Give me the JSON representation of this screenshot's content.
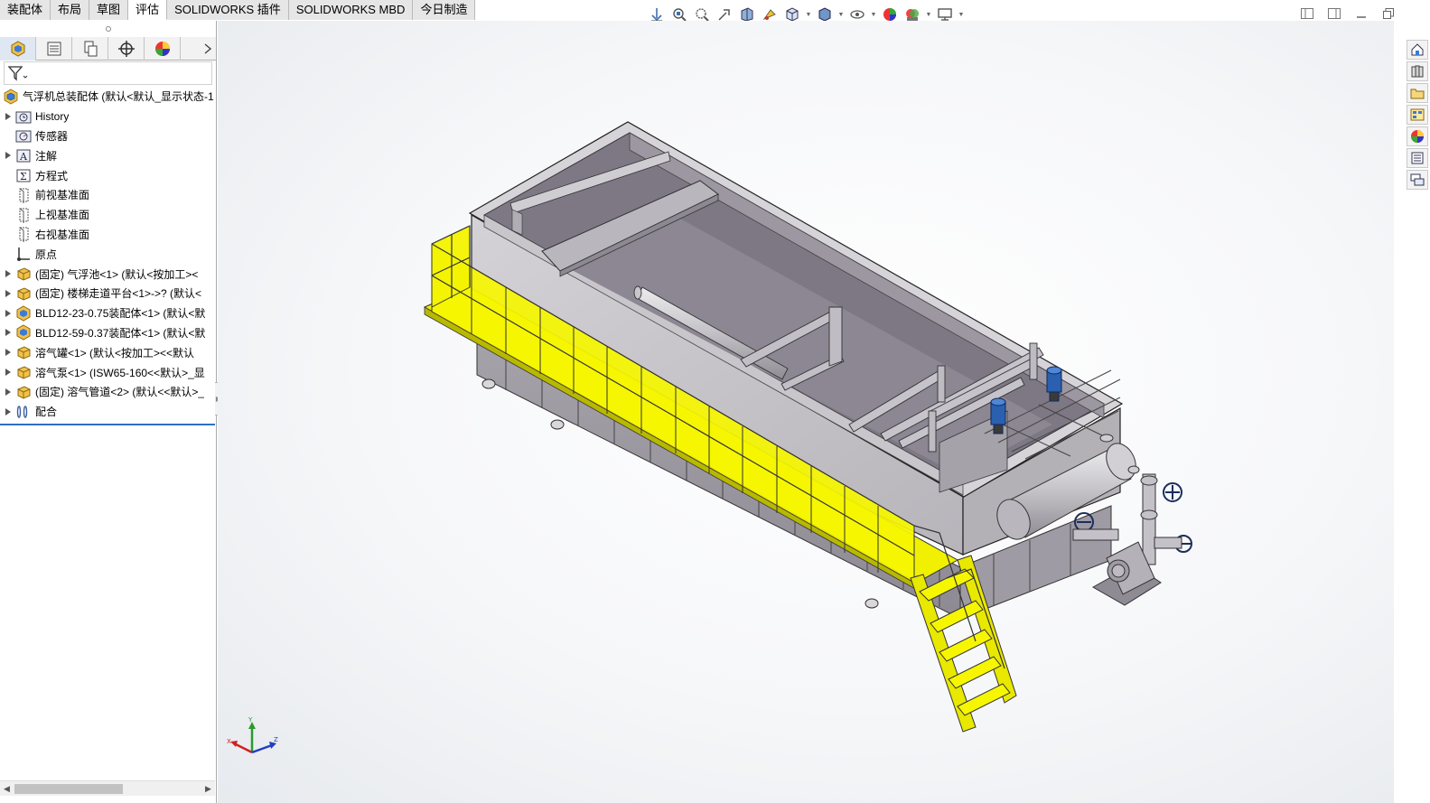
{
  "tabs": [
    {
      "label": "装配体",
      "active": false
    },
    {
      "label": "布局",
      "active": false
    },
    {
      "label": "草图",
      "active": false
    },
    {
      "label": "评估",
      "active": true
    },
    {
      "label": "SOLIDWORKS 插件",
      "active": false
    },
    {
      "label": "SOLIDWORKS MBD",
      "active": false
    },
    {
      "label": "今日制造",
      "active": false
    }
  ],
  "heads_up_toolbar": [
    "view-orientation-icon",
    "zoom-to-fit-icon",
    "zoom-to-area-icon",
    "previous-view-icon",
    "section-view-icon",
    "dynamic-annotation-icon",
    "view-orientation-cube-icon",
    "display-style-icon",
    "hide-show-items-icon",
    "edit-appearance-icon",
    "apply-scene-icon",
    "view-settings-icon"
  ],
  "panel_tabs": [
    "featuremanager-icon",
    "propertymanager-icon",
    "configurationmanager-icon",
    "dimxpert-icon",
    "display-manager-icon"
  ],
  "tree": {
    "root_label": "气浮机总装配体  (默认<默认_显示状态-1",
    "items": [
      {
        "label": "History",
        "icon": "history-folder-icon",
        "expandable": true
      },
      {
        "label": "传感器",
        "icon": "sensors-folder-icon",
        "expandable": false
      },
      {
        "label": "注解",
        "icon": "annotations-icon",
        "expandable": true
      },
      {
        "label": "方程式",
        "icon": "equations-icon",
        "expandable": false
      },
      {
        "label": "前视基准面",
        "icon": "plane-icon",
        "expandable": false
      },
      {
        "label": "上视基准面",
        "icon": "plane-icon",
        "expandable": false
      },
      {
        "label": "右视基准面",
        "icon": "plane-icon",
        "expandable": false
      },
      {
        "label": "原点",
        "icon": "origin-icon",
        "expandable": false
      },
      {
        "label": "(固定) 气浮池<1> (默认<按加工><",
        "icon": "part-icon",
        "expandable": true
      },
      {
        "label": "(固定) 楼梯走道平台<1>->? (默认<",
        "icon": "part-icon",
        "expandable": true
      },
      {
        "label": "BLD12-23-0.75装配体<1> (默认<默",
        "icon": "subassembly-icon",
        "expandable": true
      },
      {
        "label": "BLD12-59-0.37装配体<1> (默认<默",
        "icon": "subassembly-icon",
        "expandable": true
      },
      {
        "label": "溶气罐<1> (默认<按加工><<默认",
        "icon": "part-icon",
        "expandable": true
      },
      {
        "label": "溶气泵<1> (ISW65-160<<默认>_显",
        "icon": "part-icon",
        "expandable": true
      },
      {
        "label": "(固定) 溶气管道<2> (默认<<默认>_",
        "icon": "part-icon",
        "expandable": true
      },
      {
        "label": "配合",
        "icon": "mates-icon",
        "expandable": true
      }
    ]
  },
  "task_pane": [
    "solidworks-resources-icon",
    "design-library-icon",
    "file-explorer-icon",
    "view-palette-icon",
    "appearances-icon",
    "custom-properties-icon",
    "solidworks-forum-icon"
  ],
  "colors": {
    "tank_gray": "#c9c6cb",
    "tank_inner": "#7c7683",
    "walkway_yellow": "#f4f400",
    "pipe_gray": "#bdbbbf",
    "motor_blue": "#1f4e9c"
  }
}
